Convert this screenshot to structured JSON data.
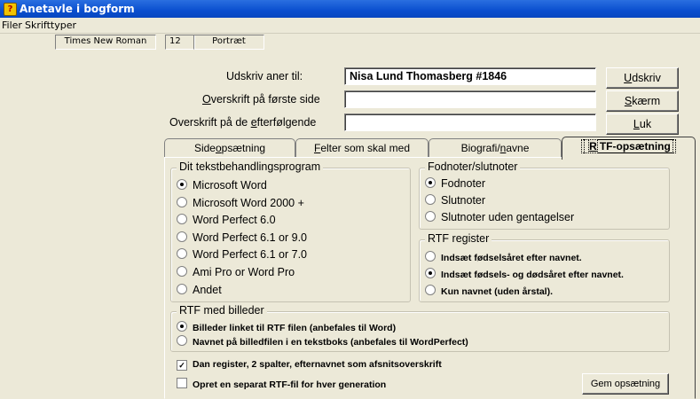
{
  "window": {
    "title": "Anetavle i bogform"
  },
  "menu": {
    "items": [
      "Filer",
      "Skrifttyper"
    ]
  },
  "fontbar": {
    "font_name": "Times New Roman",
    "font_size": "12",
    "orientation": "Portræt"
  },
  "fields": {
    "print_label": "Udskriv aner til:",
    "print_value": "Nisa Lund Thomasberg  #1846",
    "first_page_label_pre": "",
    "first_page_label_ul": "O",
    "first_page_label_post": "verskrift på første side",
    "first_page_value": "",
    "following_label_pre": "Overskrift på de ",
    "following_label_ul": "e",
    "following_label_post": "fterfølgende",
    "following_value": ""
  },
  "buttons": {
    "print_ul": "U",
    "print_rest": "dskriv",
    "screen_ul": "S",
    "screen_rest": "kærm",
    "close_ul": "L",
    "close_rest": "uk",
    "save_setup": "Gem opsætning"
  },
  "tabs": {
    "page_setup_pre": "Side",
    "page_setup_ul": "o",
    "page_setup_post": "psætning",
    "fields_pre": "",
    "fields_ul": "F",
    "fields_post": "elter som skal med",
    "bio_pre": "Biografi/",
    "bio_ul": "n",
    "bio_post": "avne",
    "rtf_pre": "",
    "rtf_ul": "R",
    "rtf_post": "TF-opsætning"
  },
  "wordproc": {
    "title": "Dit tekstbehandlingsprogram",
    "options": [
      "Microsoft Word",
      "Microsoft Word 2000 +",
      "Word Perfect 6.0",
      "Word Perfect 6.1 or 9.0",
      "Word Perfect 6.1 or 7.0",
      "Ami Pro or Word Pro",
      "Andet"
    ],
    "selected": 0
  },
  "footnotes": {
    "title": "Fodnoter/slutnoter",
    "options": [
      "Fodnoter",
      "Slutnoter",
      "Slutnoter uden gentagelser"
    ],
    "selected": 0
  },
  "register": {
    "title": "RTF register",
    "options": [
      "Indsæt fødselsåret efter navnet.",
      "Indsæt fødsels- og dødsåret efter navnet.",
      "Kun navnet (uden årstal)."
    ],
    "selected": 1
  },
  "images": {
    "title": "RTF med billeder",
    "options": [
      "Billeder linket til RTF filen (anbefales til Word)",
      "Navnet på billedfilen i en tekstboks (anbefales til WordPerfect)"
    ],
    "selected": 0
  },
  "checks": {
    "make_register": "Dan register, 2 spalter, efternavnet som afsnitsoverskrift",
    "make_register_checked": true,
    "separate_file": "Opret en separat RTF-fil for hver generation",
    "separate_file_checked": false
  }
}
